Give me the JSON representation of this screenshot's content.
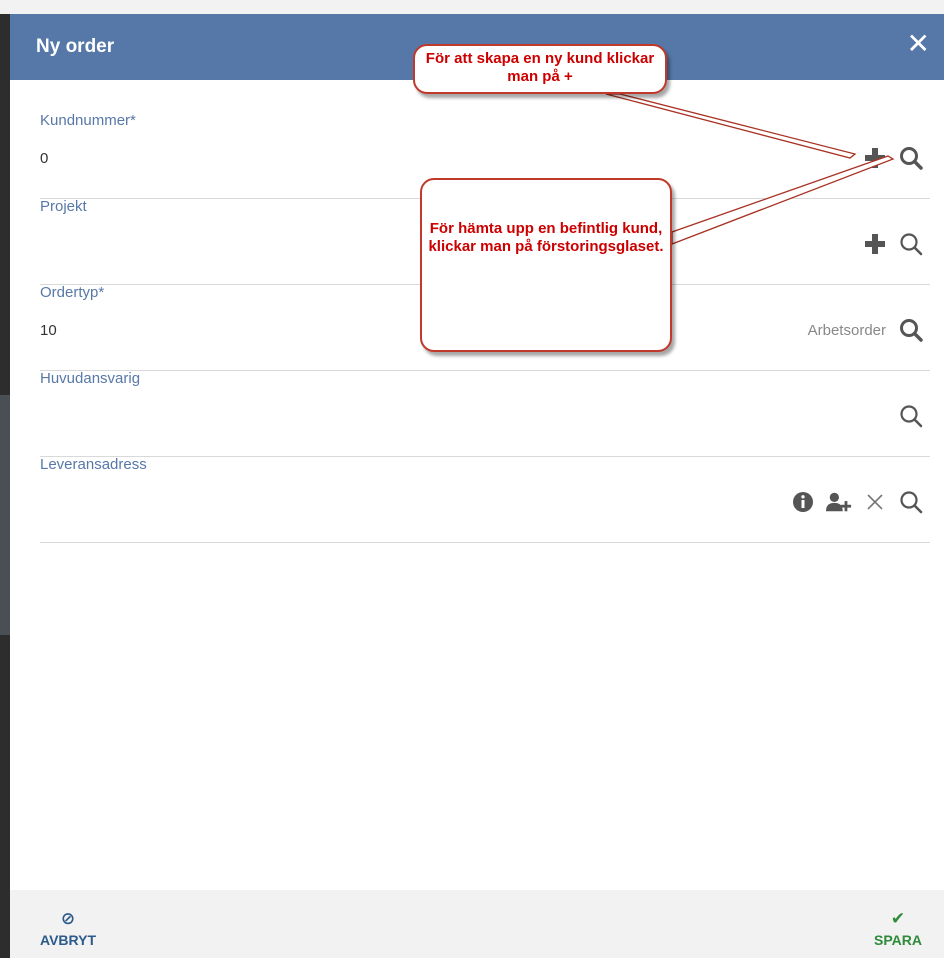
{
  "dialog": {
    "title": "Ny order",
    "close": "✕"
  },
  "fields": [
    {
      "label": "Kundnummer*",
      "value": "0",
      "icons": [
        "plus-icon",
        "search-icon"
      ]
    },
    {
      "label": "Projekt",
      "value": "",
      "icons": [
        "plus-icon",
        "search-icon"
      ]
    },
    {
      "label": "Ordertyp*",
      "value": "10",
      "extra": "Arbetsorder",
      "icons": [
        "search-icon"
      ]
    },
    {
      "label": "Huvudansvarig",
      "value": "",
      "icons": [
        "search-icon"
      ]
    },
    {
      "label": "Leveransadress",
      "value": "",
      "icons": [
        "info-icon",
        "add-user-icon",
        "clear-icon",
        "search-icon"
      ]
    }
  ],
  "callouts": {
    "create": "För att skapa en ny kund klickar man på +",
    "fetch": "För hämta upp en befintlig kund, klickar man på förstoringsglaset."
  },
  "footer": {
    "cancel_label": "AVBRYT",
    "save_label": "SPARA",
    "cancel_icon": "⊘",
    "save_icon": "✔"
  },
  "colors": {
    "header": "#5578a8",
    "label": "#5878a8",
    "callout_text": "#cc0000",
    "save": "#2f8a3a",
    "cancel": "#2c5a8a"
  }
}
